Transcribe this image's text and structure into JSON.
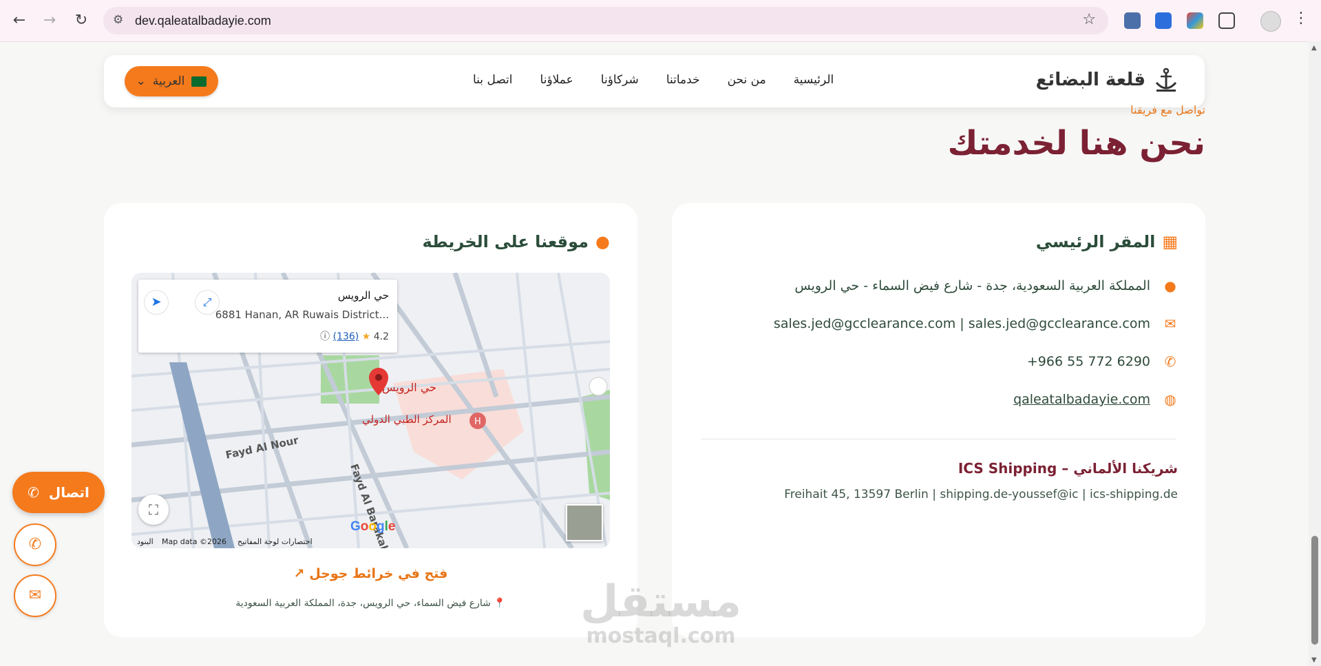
{
  "browser": {
    "url": "dev.qaleatalbadayie.com"
  },
  "header": {
    "logo_text": "قلعة البضائع",
    "menu": [
      "الرئيسية",
      "من نحن",
      "خدماتنا",
      "شركاؤنا",
      "عملاؤنا",
      "اتصل بنا"
    ],
    "language": "العربية"
  },
  "hero": {
    "eyebrow": "تواصل مع فريقنا",
    "title": "نحن هنا لخدمتك"
  },
  "hq": {
    "title": "المقر الرئيسي",
    "address": "المملكة العربية السعودية، جدة - شارع فيض السماء - حي الرويس",
    "email": "sales.jed@gcclearance.com | sales.jed@gcclearance.com",
    "phone": "+966 55 772 6290",
    "website": "qaleatalbadayie.com",
    "partner_title": "شريكنا الألماني – ICS Shipping",
    "partner_info": "Freihait 45, 13597 Berlin | shipping.de-youssef@ic | ics-shipping.de"
  },
  "map_card": {
    "title": "موقعنا على الخريطة",
    "place_name": "حي الرويس",
    "place_address": "6881 Hanan, AR Ruwais District...",
    "rating": "4.2",
    "rating_count": "(136)",
    "pin_label": "حي الرويس",
    "poi_label": "المركز الطبي الدولي",
    "street_1": "Fayd Al Nour",
    "street_2": "Fayd Al Barakah",
    "map_data": "Map data ©2026",
    "shortcuts": "اختصارات لوحة المفاتيح",
    "terms": "البنود",
    "open_in_maps": "فتح في خرائط جوجل",
    "address_note": "📍 شارع فيض السماء، حي الرويس، جدة، المملكة العربية السعودية"
  },
  "floating": {
    "call_label": "اتصال"
  },
  "watermark": {
    "arabic": "مستقل",
    "latin": "mostaql.com"
  }
}
